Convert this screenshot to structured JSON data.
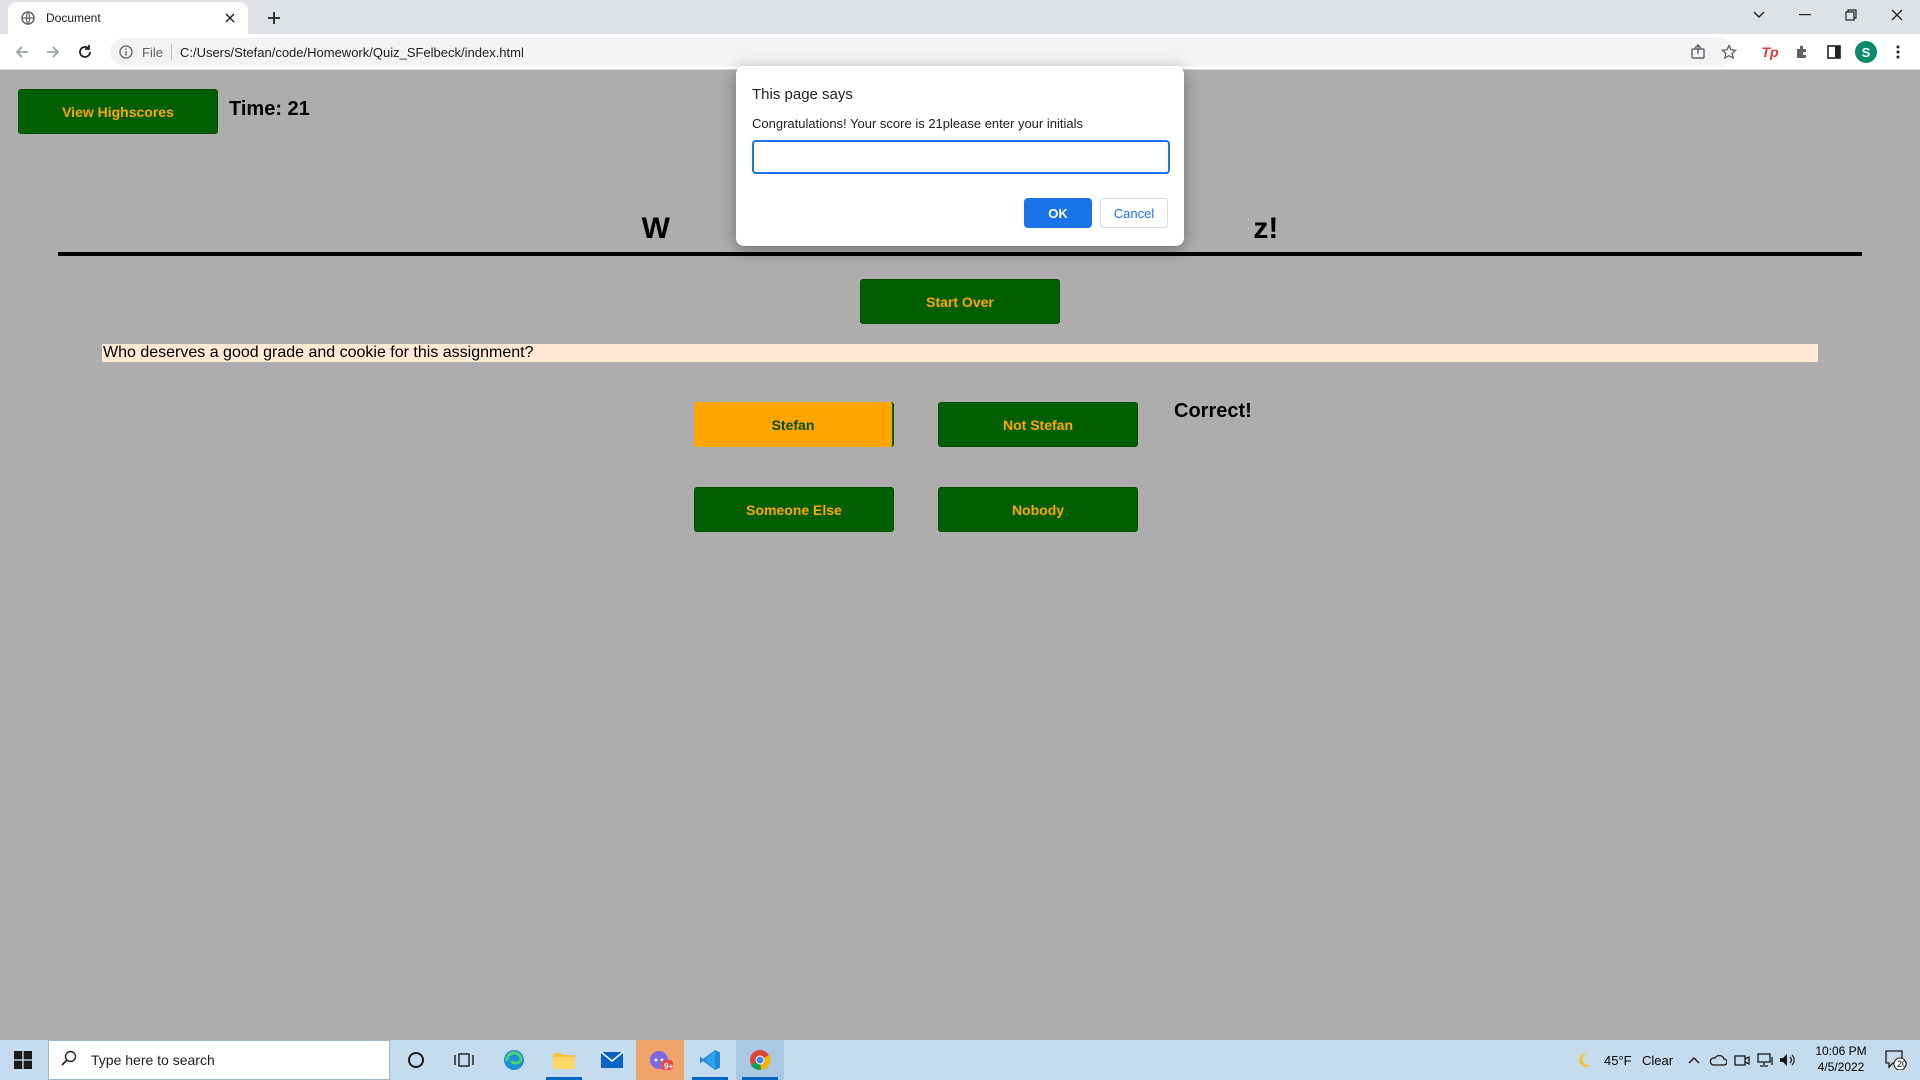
{
  "browser": {
    "tab_title": "Document",
    "url_scheme": "File",
    "url": "C:/Users/Stefan/code/Homework/Quiz_SFelbeck/index.html",
    "profile_initial": "S"
  },
  "page": {
    "highscores_label": "View Highscores",
    "time_label": "Time: 21",
    "heading": "W                                                                      z!",
    "start_over_label": "Start Over",
    "question": "Who deserves a good grade and cookie for this assignment?",
    "answers": [
      "Stefan",
      "Not Stefan",
      "Someone Else",
      "Nobody"
    ],
    "selected_answer": "Stefan",
    "feedback": "Correct!",
    "colors": {
      "background": "#adadad",
      "button_green": "#015f01",
      "button_text": "#ffa500",
      "question_band": "#ffe8d4"
    }
  },
  "dialog": {
    "title": "This page says",
    "message": "Congratulations! Your score is 21please enter your initials",
    "input_value": "",
    "ok_label": "OK",
    "cancel_label": "Cancel"
  },
  "taskbar": {
    "search_placeholder": "Type here to search",
    "weather_temp": "45°F",
    "weather_desc": "Clear",
    "time": "10:06 PM",
    "date": "4/5/2022",
    "notification_count": "20",
    "mail_badge": "9+"
  }
}
